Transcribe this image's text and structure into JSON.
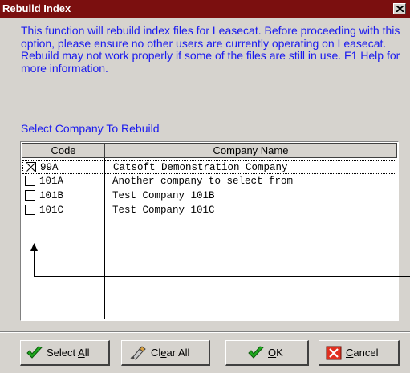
{
  "window": {
    "title": "Rebuild Index"
  },
  "description": "This function will rebuild index files for Leasecat. Before proceeding with this option, please ensure no other users are currently operating on Leasecat. Rebuild may not work properly if some of the files are still in use. F1 Help for more information.",
  "section_label": "Select Company To Rebuild",
  "grid": {
    "headers": {
      "code": "Code",
      "name": "Company Name"
    },
    "rows": [
      {
        "code": "99A",
        "name": "Catsoft Demonstration Company",
        "checked": true,
        "selected": true
      },
      {
        "code": "101A",
        "name": "Another company to select from",
        "checked": false,
        "selected": false
      },
      {
        "code": "101B",
        "name": "Test Company 101B",
        "checked": false,
        "selected": false
      },
      {
        "code": "101C",
        "name": "Test Company 101C",
        "checked": false,
        "selected": false
      }
    ]
  },
  "buttons": {
    "select_all": {
      "pre": "Select ",
      "accel": "A",
      "post": "ll",
      "icon": "green-check-icon"
    },
    "clear_all": {
      "pre": "Cl",
      "accel": "e",
      "post": "ar All",
      "icon": "eraser-icon"
    },
    "ok": {
      "pre": "",
      "accel": "O",
      "post": "K",
      "icon": "green-check-icon"
    },
    "cancel": {
      "pre": "",
      "accel": "C",
      "post": "ancel",
      "icon": "red-x-icon"
    }
  },
  "colors": {
    "titlebar": "#7b0f0f",
    "text_blue": "#1a1aee",
    "face": "#d6d3ce"
  }
}
